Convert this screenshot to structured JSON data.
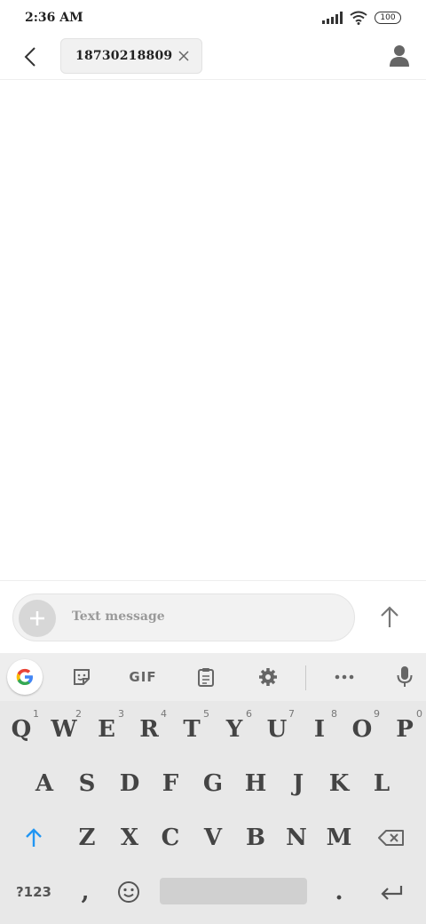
{
  "status_bar": {
    "time": "2:36 AM",
    "battery": "100",
    "icons": [
      "signal-icon",
      "wifi-icon",
      "battery-icon"
    ]
  },
  "header": {
    "recipient": "18730218809",
    "icons": [
      "back-arrow-icon",
      "close-icon",
      "contact-icon"
    ]
  },
  "compose": {
    "placeholder": "Text message",
    "icons": [
      "plus-icon",
      "send-arrow-icon"
    ]
  },
  "keyboard": {
    "toolbar": {
      "gif_label": "GIF",
      "icons": [
        "google-icon",
        "sticker-icon",
        "clipboard-icon",
        "settings-icon",
        "more-icon",
        "mic-icon"
      ]
    },
    "row1": [
      {
        "label": "Q",
        "hint": "1"
      },
      {
        "label": "W",
        "hint": "2"
      },
      {
        "label": "E",
        "hint": "3"
      },
      {
        "label": "R",
        "hint": "4"
      },
      {
        "label": "T",
        "hint": "5"
      },
      {
        "label": "Y",
        "hint": "6"
      },
      {
        "label": "U",
        "hint": "7"
      },
      {
        "label": "I",
        "hint": "8"
      },
      {
        "label": "O",
        "hint": "9"
      },
      {
        "label": "P",
        "hint": "0"
      }
    ],
    "row2": [
      "A",
      "S",
      "D",
      "F",
      "G",
      "H",
      "J",
      "K",
      "L"
    ],
    "row3": [
      "Z",
      "X",
      "C",
      "V",
      "B",
      "N",
      "M"
    ],
    "row4": {
      "symbols_label": "?123",
      "comma": ",",
      "period": "."
    },
    "colors": {
      "shift_accent": "#2196f3",
      "background": "#e8e8e8"
    }
  }
}
